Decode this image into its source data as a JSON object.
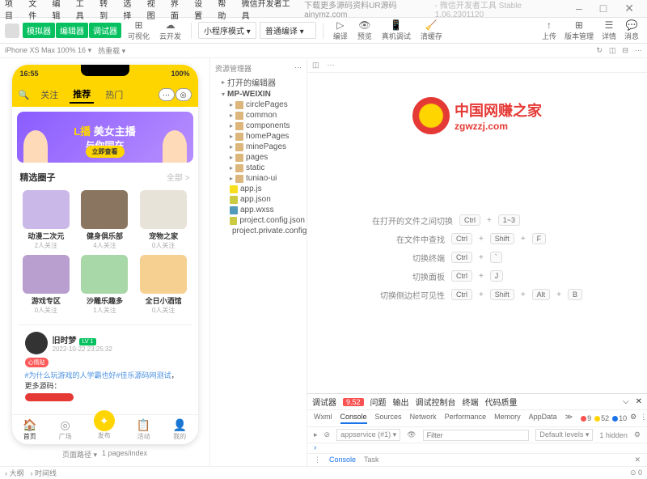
{
  "menubar": [
    "项目",
    "文件",
    "编辑",
    "工具",
    "转到",
    "选择",
    "视图",
    "界面",
    "设置",
    "帮助",
    "微信开发者工具"
  ],
  "title_center": "下载更多源码资料UR源码ainymz.com",
  "title_right": "- 微信开发者工具 Stable 1.06.2301120",
  "toolbar": {
    "mode_buttons": [
      "模拟器",
      "编辑器",
      "调试器"
    ],
    "icons": [
      {
        "glyph": "⊞",
        "label": "可视化"
      },
      {
        "glyph": "☁",
        "label": "云开发"
      }
    ],
    "select1": "小程序模式",
    "select2": "普通编译",
    "mid_icons": [
      {
        "glyph": "▷",
        "label": "编译"
      },
      {
        "glyph": "👁",
        "label": "预览"
      },
      {
        "glyph": "📱",
        "label": "真机调试"
      },
      {
        "glyph": "🧹",
        "label": "清缓存"
      }
    ],
    "right_icons": [
      {
        "glyph": "↑",
        "label": "上传"
      },
      {
        "glyph": "⊞",
        "label": "版本管理"
      },
      {
        "glyph": "☰",
        "label": "详情"
      },
      {
        "glyph": "💬",
        "label": "消息"
      }
    ]
  },
  "subbar": {
    "device": "iPhone XS Max 100% 16 ▾",
    "theme": "热重载 ▾"
  },
  "phone": {
    "time": "16:55",
    "battery": "100%",
    "search_icon": "🔍",
    "tabs": [
      "关注",
      "推荐",
      "热门"
    ],
    "active_tab": 1,
    "banner": {
      "title": "美女主播",
      "subtitle": "与你同在",
      "btn": "立即查看"
    },
    "section": {
      "title": "精选圈子",
      "more": "全部 >"
    },
    "circles": [
      {
        "name": "动漫二次元",
        "count": "2人关注",
        "color": "#c9b8e8"
      },
      {
        "name": "健身俱乐部",
        "count": "4人关注",
        "color": "#8a7560"
      },
      {
        "name": "宠物之家",
        "count": "0人关注",
        "color": "#e8e3d8"
      },
      {
        "name": "游戏专区",
        "count": "0人关注",
        "color": "#b89fcf"
      },
      {
        "name": "沙雕乐趣多",
        "count": "1人关注",
        "color": "#a8d8a8"
      },
      {
        "name": "全日小酒馆",
        "count": "0人关注",
        "color": "#f5d090"
      }
    ],
    "post": {
      "user": "旧时梦",
      "level": "LV 1",
      "time": "2022-10-22 23:25:32",
      "tag": "心情贴",
      "content_link": "#为什么玩游戏的人学霸也好#佳乐源码网测试",
      "content_plain": "，更多源码：",
      "redacted": true
    },
    "bottombar": [
      {
        "icon": "🏠",
        "label": "首页"
      },
      {
        "icon": "◎",
        "label": "广场"
      },
      {
        "icon": "✦",
        "label": "发布"
      },
      {
        "icon": "📋",
        "label": "活动"
      },
      {
        "icon": "👤",
        "label": "我的"
      }
    ]
  },
  "sim_footer": {
    "page_count": "页面路径 ▾",
    "path": "1 pages/index"
  },
  "tree": {
    "header": "资源管理器",
    "root_open": "打开的编辑器",
    "project": "MP-WEIXIN",
    "items": [
      {
        "name": "circlePages",
        "type": "folder"
      },
      {
        "name": "common",
        "type": "folder"
      },
      {
        "name": "components",
        "type": "folder"
      },
      {
        "name": "homePages",
        "type": "folder"
      },
      {
        "name": "minePages",
        "type": "folder"
      },
      {
        "name": "pages",
        "type": "folder"
      },
      {
        "name": "static",
        "type": "folder"
      },
      {
        "name": "tuniao-ui",
        "type": "folder"
      },
      {
        "name": "app.js",
        "type": "js"
      },
      {
        "name": "app.json",
        "type": "json"
      },
      {
        "name": "app.wxss",
        "type": "wxss"
      },
      {
        "name": "project.config.json",
        "type": "json"
      },
      {
        "name": "project.private.config.js...",
        "type": "json"
      }
    ]
  },
  "watermark": {
    "cn": "中国网赚之家",
    "en": "zgwzzj.com"
  },
  "shortcuts": [
    {
      "label": "在打开的文件之间切换",
      "keys": [
        "Ctrl",
        "1~3"
      ]
    },
    {
      "label": "在文件中查找",
      "keys": [
        "Ctrl",
        "Shift",
        "F"
      ]
    },
    {
      "label": "切换终端",
      "keys": [
        "Ctrl",
        "`"
      ]
    },
    {
      "label": "切换面板",
      "keys": [
        "Ctrl",
        "J"
      ]
    },
    {
      "label": "切换侧边栏可见性",
      "keys": [
        "Ctrl",
        "Shift",
        "Alt",
        "B"
      ]
    }
  ],
  "debugger": {
    "title": "调试器",
    "badge": "9.52",
    "side_tabs": [
      "问题",
      "输出",
      "调试控制台",
      "终端",
      "代码质量"
    ],
    "tabs": [
      "Wxml",
      "Console",
      "Sources",
      "Network",
      "Performance",
      "Memory",
      "AppData",
      "≫"
    ],
    "active_tab": 1,
    "stats": [
      {
        "color": "#fa5151",
        "val": "9"
      },
      {
        "color": "#ffd500",
        "val": "52"
      },
      {
        "color": "#1a73e8",
        "val": "10"
      }
    ],
    "gear": "⚙",
    "toolbar": {
      "context": "appservice (#1)",
      "filter_placeholder": "Filter",
      "levels": "Default levels ▾",
      "hidden": "1 hidden"
    },
    "footer": [
      "Console",
      "Task"
    ]
  },
  "statusbar_bottom": {
    "outline": "大纲",
    "timeline": "时间线"
  }
}
